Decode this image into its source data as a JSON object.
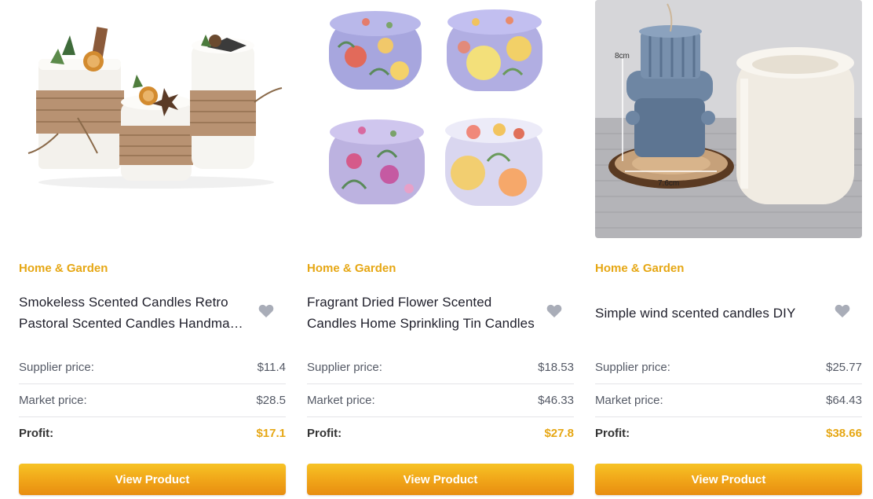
{
  "products": [
    {
      "category": "Home & Garden",
      "title": "Smokeless Scented Candles Retro Pastoral Scented Candles Handmade Soy Wax",
      "image_icon": "candle-product-image",
      "prices": {
        "supplier_label": "Supplier price:",
        "supplier_value": "$11.4",
        "market_label": "Market price:",
        "market_value": "$28.5",
        "profit_label": "Profit:",
        "profit_value": "$17.1"
      },
      "button_label": "View Product"
    },
    {
      "category": "Home & Garden",
      "title": "Fragrant Dried Flower Scented Candles Home Sprinkling Tin Candles",
      "image_icon": "candle-tin-product-image",
      "prices": {
        "supplier_label": "Supplier price:",
        "supplier_value": "$18.53",
        "market_label": "Market price:",
        "market_value": "$46.33",
        "profit_label": "Profit:",
        "profit_value": "$27.8"
      },
      "button_label": "View Product"
    },
    {
      "category": "Home & Garden",
      "title": "Simple wind scented candles DIY",
      "image_icon": "candle-mold-product-image",
      "image_labels": {
        "height": "8cm",
        "width": "7.6cm"
      },
      "prices": {
        "supplier_label": "Supplier price:",
        "supplier_value": "$25.77",
        "market_label": "Market price:",
        "market_value": "$64.43",
        "profit_label": "Profit:",
        "profit_value": "$38.66"
      },
      "button_label": "View Product"
    }
  ],
  "colors": {
    "accent": "#e6a714",
    "button_top": "#f7c325",
    "button_bottom": "#e88d10",
    "heart": "#a9adb8"
  },
  "icons": {
    "favorite": "heart-icon"
  }
}
